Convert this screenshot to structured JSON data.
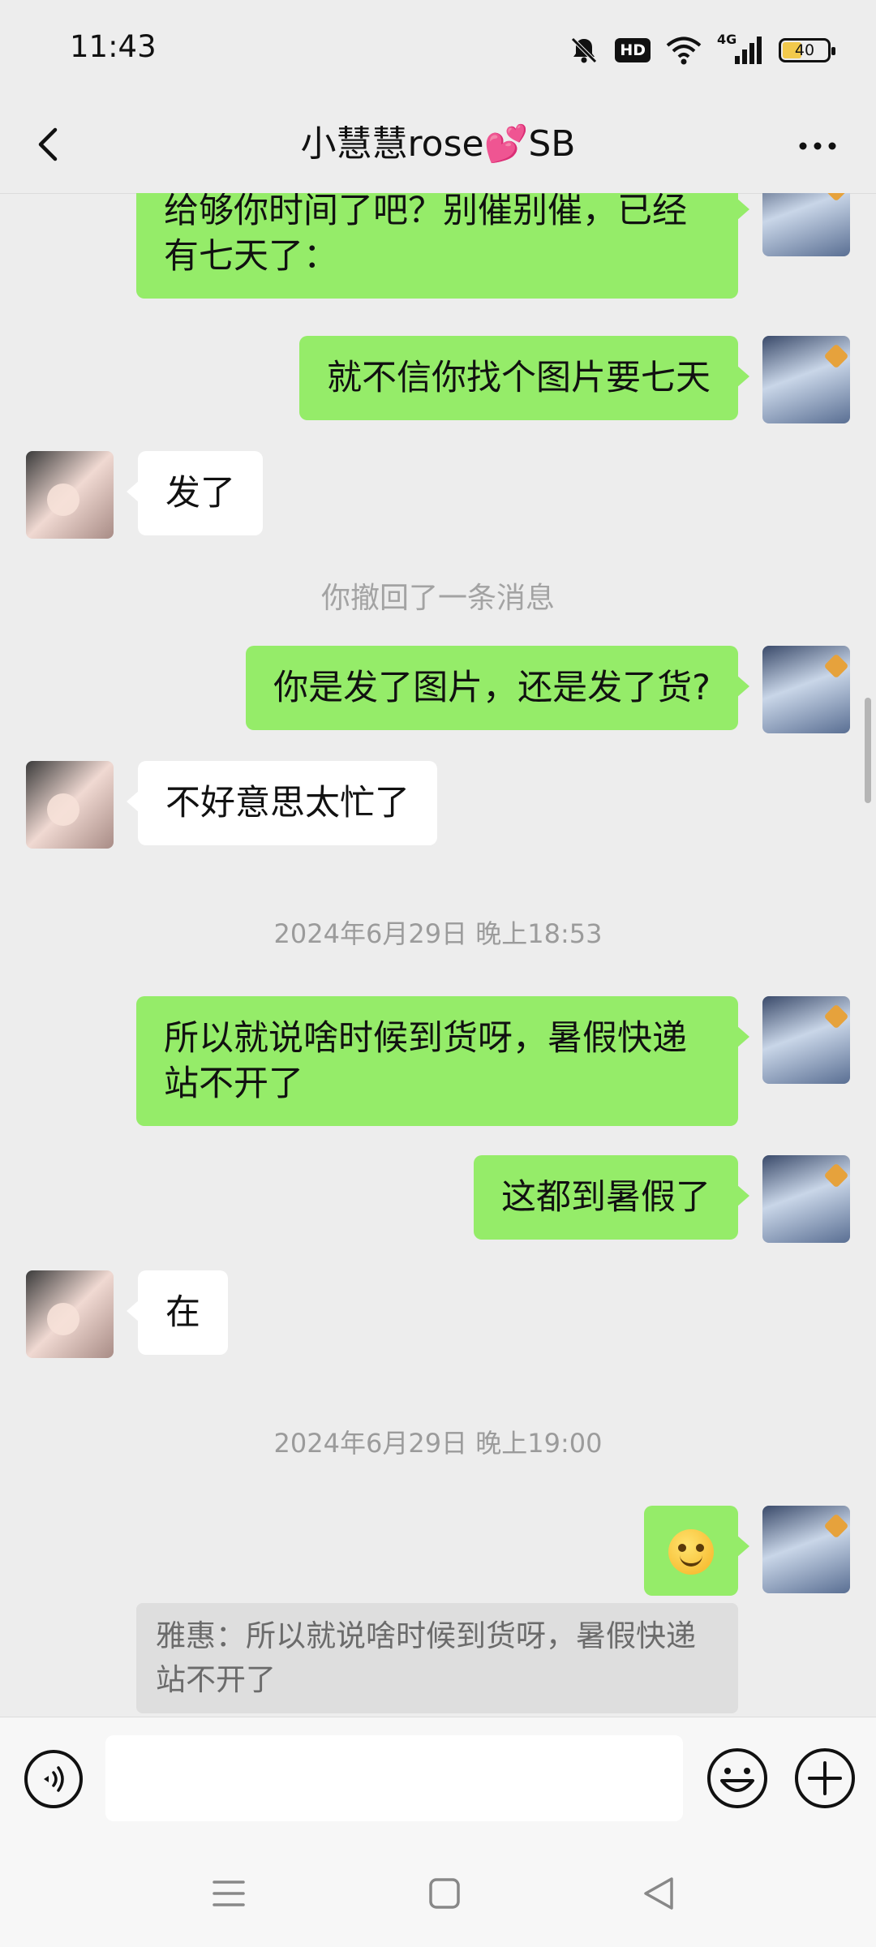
{
  "status_bar": {
    "time": "11:43",
    "hd_badge": "HD",
    "network": "4G",
    "battery": "40"
  },
  "header": {
    "title": "小慧慧rose💕SB"
  },
  "messages": [
    {
      "text": "给够你时间了吧？别催别催，已经有七天了："
    },
    {
      "text": "就不信你找个图片要七天"
    },
    {
      "text": "发了"
    },
    {
      "text": "你撤回了一条消息"
    },
    {
      "text": "你是发了图片，还是发了货?"
    },
    {
      "text": "不好意思太忙了"
    },
    {
      "text": "2024年6月29日 晚上18:53"
    },
    {
      "text": "所以就说啥时候到货呀，暑假快递站不开了"
    },
    {
      "text": "这都到暑假了"
    },
    {
      "text": "在"
    },
    {
      "text": "2024年6月29日 晚上19:00"
    },
    {
      "text": "雅惠：所以就说啥时候到货呀，暑假快递站不开了"
    }
  ],
  "input": {
    "placeholder": ""
  }
}
